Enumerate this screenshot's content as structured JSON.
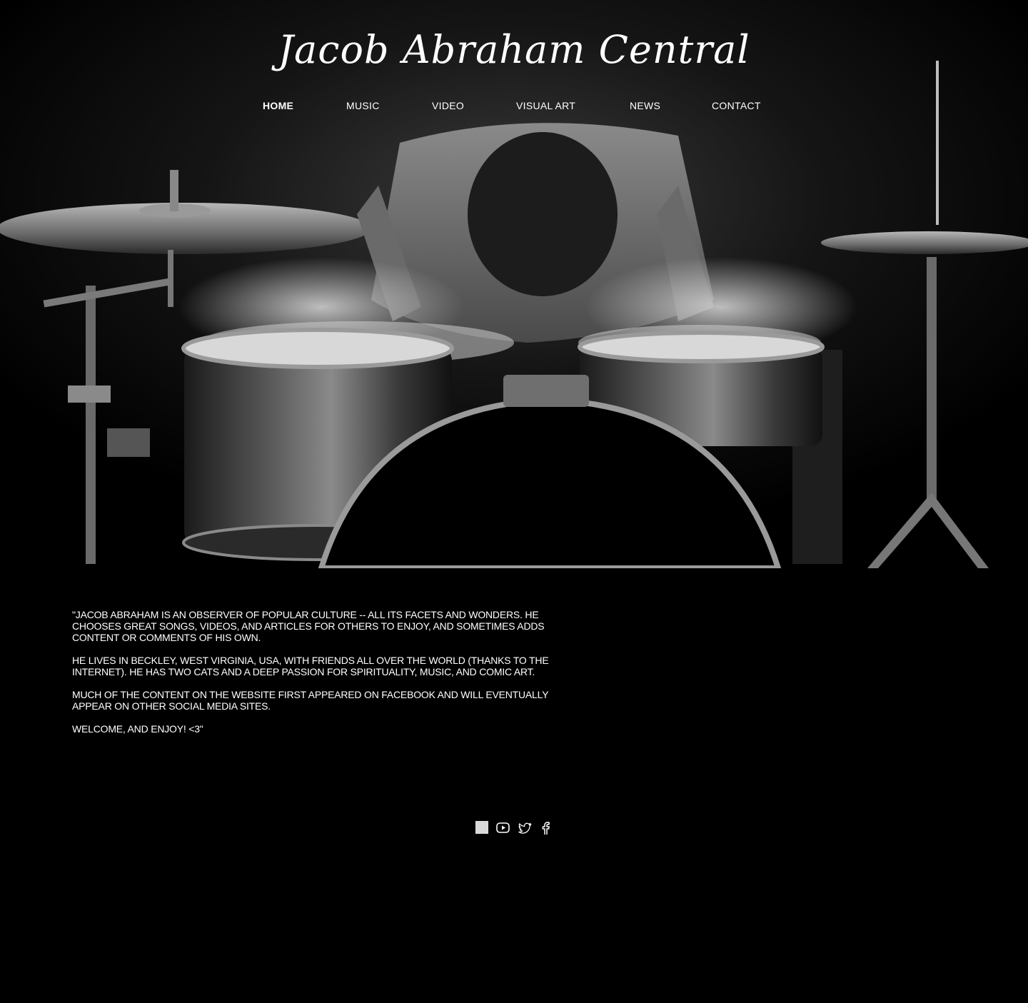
{
  "site": {
    "title": "Jacob Abraham Central"
  },
  "nav": {
    "items": [
      {
        "label": "HOME",
        "active": true
      },
      {
        "label": "MUSIC",
        "active": false
      },
      {
        "label": "VIDEO",
        "active": false
      },
      {
        "label": "VISUAL ART",
        "active": false
      },
      {
        "label": "NEWS",
        "active": false
      },
      {
        "label": "CONTACT",
        "active": false
      }
    ]
  },
  "hero": {
    "image_subject": "drummer-photo"
  },
  "about": {
    "paragraphs": [
      "\"JACOB ABRAHAM IS AN OBSERVER OF POPULAR CULTURE -- ALL ITS FACETS AND WONDERS. HE CHOOSES GREAT SONGS, VIDEOS, AND ARTICLES FOR OTHERS TO ENJOY, AND SOMETIMES ADDS CONTENT OR COMMENTS OF HIS OWN.",
      "HE LIVES IN BECKLEY, WEST VIRGINIA, USA, WITH FRIENDS ALL OVER THE WORLD (THANKS TO THE INTERNET). HE HAS TWO CATS AND A DEEP PASSION FOR SPIRITUALITY, MUSIC, AND COMIC ART.",
      "MUCH OF THE CONTENT ON THE WEBSITE FIRST APPEARED ON FACEBOOK AND WILL EVENTUALLY APPEAR ON OTHER SOCIAL MEDIA SITES.",
      "WELCOME, AND ENJOY! <3\""
    ]
  },
  "social": {
    "icons": [
      "blank-square-icon",
      "youtube-icon",
      "twitter-icon",
      "facebook-icon"
    ]
  },
  "colors": {
    "background": "#000000",
    "text": "#ffffff",
    "placeholder_icon": "#d9d9d9"
  }
}
